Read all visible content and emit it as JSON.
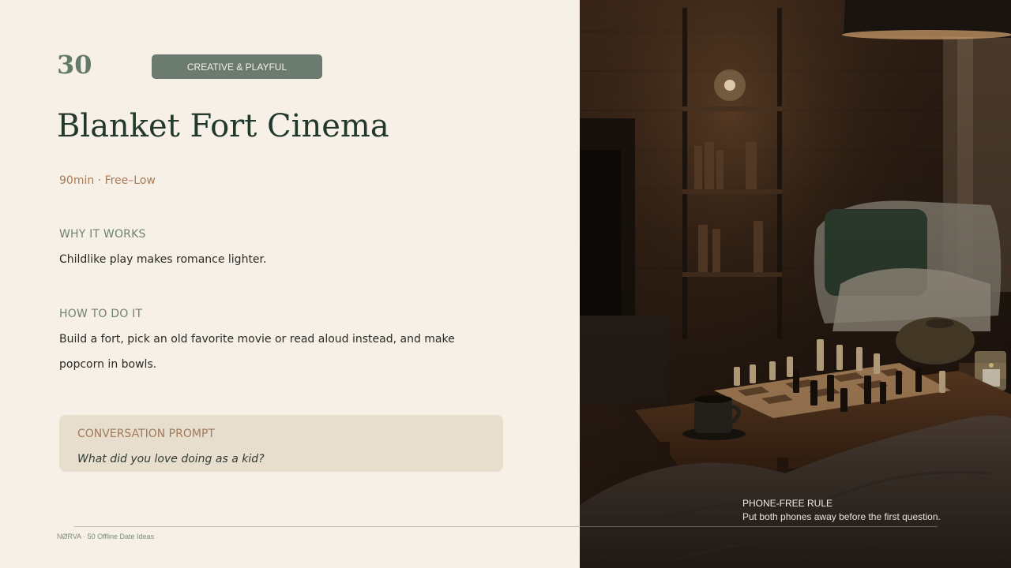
{
  "card": {
    "number": "30",
    "category": "CREATIVE & PLAYFUL",
    "title": "Blanket Fort Cinema",
    "meta": "90min · Free–Low"
  },
  "why": {
    "label": "WHY IT WORKS",
    "text": "Childlike play makes romance lighter."
  },
  "how": {
    "label": "HOW TO DO IT",
    "text": "Build a fort, pick an old favorite movie or read aloud instead, and make popcorn in bowls."
  },
  "prompt": {
    "label": "CONVERSATION PROMPT",
    "text": "What did you love doing as a kid?"
  },
  "rule": {
    "title": "PHONE-FREE RULE",
    "text": "Put both phones away before the first question."
  },
  "footer": {
    "text": "NØRVA · 50 Offline Date Ideas"
  },
  "photo": {
    "subject": "cozy cabin living room with chess board, teapot, candle, mug and blankets"
  },
  "colors": {
    "background": "#f6f0e7",
    "accent": "#6c7b6f",
    "title": "#22382d",
    "meta": "#a97a57",
    "prompt_bg": "#e8dece"
  }
}
